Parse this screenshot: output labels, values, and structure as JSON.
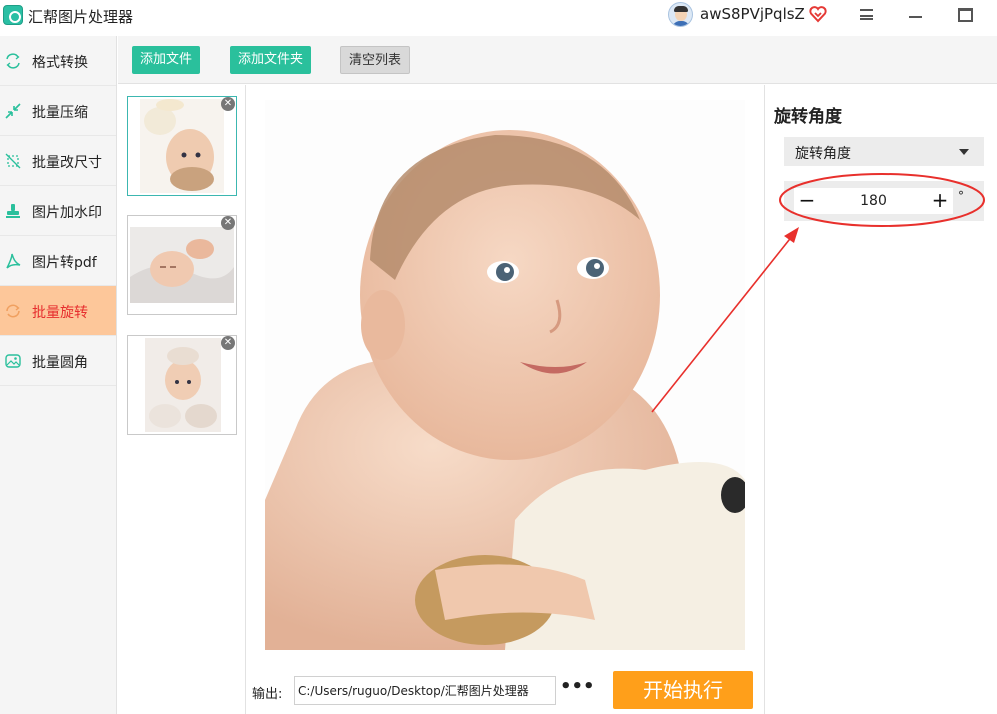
{
  "app": {
    "title": "汇帮图片处理器",
    "user_name": "awS8PVjPqlsZ"
  },
  "titlebar": {
    "menu_icon": "hamburger-menu-icon",
    "minimize_icon": "minimize-icon",
    "maximize_icon": "maximize-icon",
    "vip_icon": "vip-heart-icon"
  },
  "sidebar": {
    "items": [
      {
        "label": "格式转换",
        "icon": "format-convert-icon",
        "active": false
      },
      {
        "label": "批量压缩",
        "icon": "compress-icon",
        "active": false
      },
      {
        "label": "批量改尺寸",
        "icon": "resize-icon",
        "active": false
      },
      {
        "label": "图片加水印",
        "icon": "stamp-watermark-icon",
        "active": false
      },
      {
        "label": "图片转pdf",
        "icon": "pdf-icon",
        "active": false
      },
      {
        "label": "批量旋转",
        "icon": "rotate-icon",
        "active": true
      },
      {
        "label": "批量圆角",
        "icon": "image-rounded-icon",
        "active": false
      }
    ]
  },
  "toolbar": {
    "add_file": "添加文件",
    "add_folder": "添加文件夹",
    "clear_list": "清空列表"
  },
  "rotate_panel": {
    "title": "旋转角度",
    "mode_selected": "旋转角度",
    "angle_value": "180",
    "degree_unit": "°",
    "minus": "−",
    "plus": "+"
  },
  "output": {
    "label": "输出:",
    "path": "C:/Users/ruguo/Desktop/汇帮图片处理器",
    "more": "•••",
    "start_label": "开始执行"
  },
  "colors": {
    "accent_green": "#2ac09c",
    "active_orange": "#fdc79a",
    "active_text_red": "#e62e2e",
    "start_orange": "#ff9f1a",
    "annotation_red": "#e8302c"
  }
}
